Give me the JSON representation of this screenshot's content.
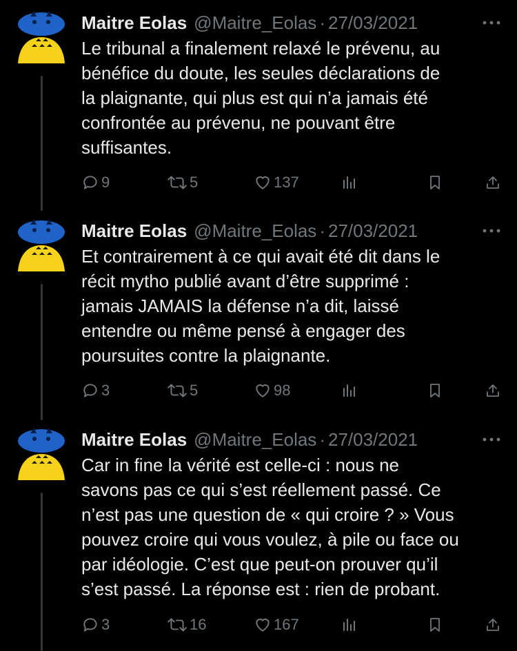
{
  "tweets": [
    {
      "author": "Maitre Eolas",
      "handle": "@Maitre_Eolas",
      "separator": "·",
      "date": "27/03/2021",
      "text": "Le tribunal a finalement relaxé le prévenu, au\nbénéfice du doute, les seules déclarations de\nla plaignante, qui plus est qui n’a jamais été\nconfrontée au prévenu, ne pouvant être\nsuffisantes.",
      "replies": "9",
      "retweets": "5",
      "likes": "137"
    },
    {
      "author": "Maitre Eolas",
      "handle": "@Maitre_Eolas",
      "separator": "·",
      "date": "27/03/2021",
      "text": "Et contrairement à ce qui avait été dit dans le\nrécit mytho publié avant d’être supprimé :\njamais JAMAIS la défense n’a dit, laissé\nentendre ou même pensé à engager des\npoursuites contre la plaignante.",
      "replies": "3",
      "retweets": "5",
      "likes": "98"
    },
    {
      "author": "Maitre Eolas",
      "handle": "@Maitre_Eolas",
      "separator": "·",
      "date": "27/03/2021",
      "text": "Car in fine la vérité est celle-ci : nous ne\nsavons pas ce qui s’est réellement passé. Ce\nn’est pas une question de « qui croire ? » Vous\npouvez croire qui vous voulez, à pile ou face ou\npar idéologie. C’est que peut-on prouver qu’il\ns’est passé. La réponse est : rien de probant.",
      "replies": "3",
      "retweets": "16",
      "likes": "167"
    }
  ],
  "icons": {
    "avatar": "totoro-avatar-icon",
    "more": "more-icon",
    "reply": "reply-icon",
    "retweet": "retweet-icon",
    "like": "heart-icon",
    "views": "views-icon",
    "bookmark": "bookmark-icon",
    "share": "share-icon"
  },
  "colors": {
    "background": "#000000",
    "text_primary": "#e7e9ea",
    "text_secondary": "#71767b",
    "avatar_blue": "#1f63c8",
    "avatar_yellow": "#f7d21b",
    "thread_line": "#333639"
  }
}
